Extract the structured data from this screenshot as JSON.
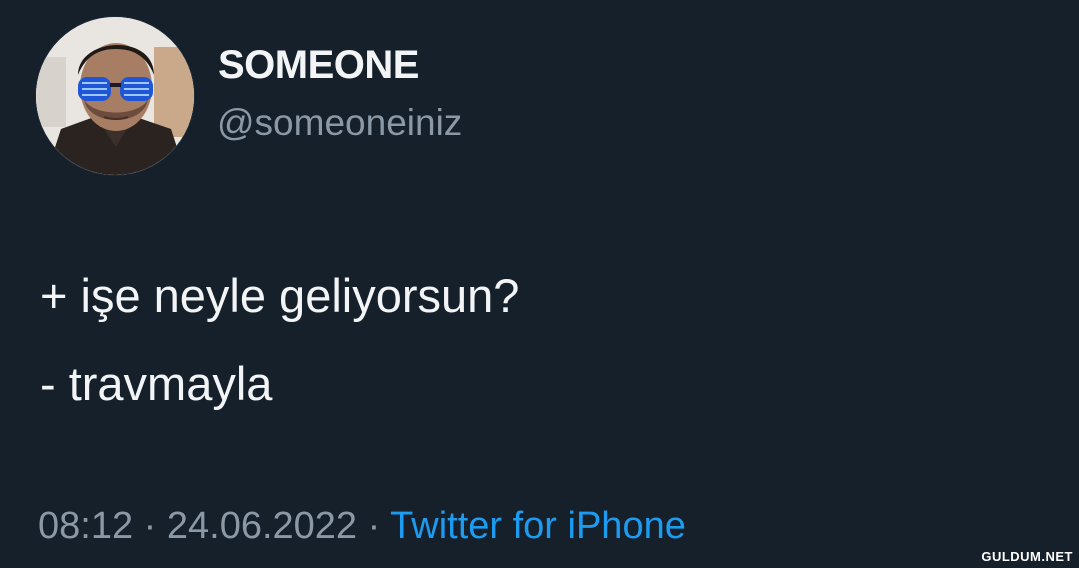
{
  "author": {
    "display_name": "SOMEONE",
    "handle": "@someoneiniz"
  },
  "tweet": {
    "lines": [
      "+ işe neyle geliyorsun?",
      "- travmayla"
    ]
  },
  "meta": {
    "time": "08:12",
    "separator": " · ",
    "date": "24.06.2022",
    "source": "Twitter for iPhone"
  },
  "watermark": "GULDUM.NET",
  "colors": {
    "background": "#15202b",
    "text": "#f2f4f6",
    "secondary": "#8b98a5",
    "link": "#1d9bf0"
  }
}
